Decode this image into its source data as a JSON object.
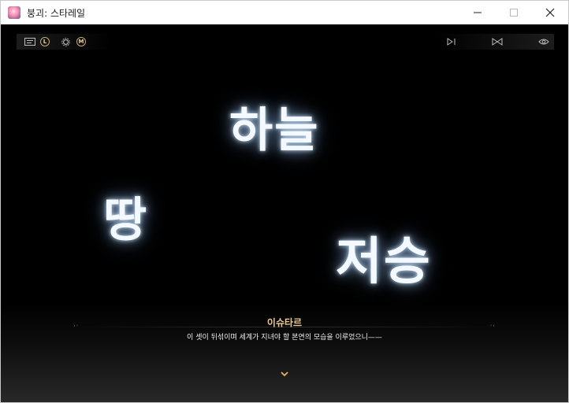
{
  "window": {
    "title": "붕괴: 스타레일",
    "controls": {
      "minimize": "—",
      "maximize": "☐",
      "close": "✕"
    }
  },
  "hud": {
    "left": {
      "menu_icon": "dialog-log-icon",
      "badge_l": "L",
      "settings_icon": "gear-icon",
      "badge_m": "M"
    },
    "right": {
      "auto_icon": "auto-play-icon",
      "skip_icon": "skip-icon",
      "hide_icon": "hide-ui-icon"
    }
  },
  "scene": {
    "words": [
      "하늘",
      "땅",
      "저승"
    ]
  },
  "dialog": {
    "speaker": "이슈타르",
    "text": "이 셋이 뒤섞이며 세계가 지녀야 할 본연의 모습을 이루었으니——",
    "next_icon": "chevron-down-icon"
  },
  "colors": {
    "speaker": "#e9c893",
    "accent": "#e3b65a",
    "glow": "#f4f9ff"
  }
}
